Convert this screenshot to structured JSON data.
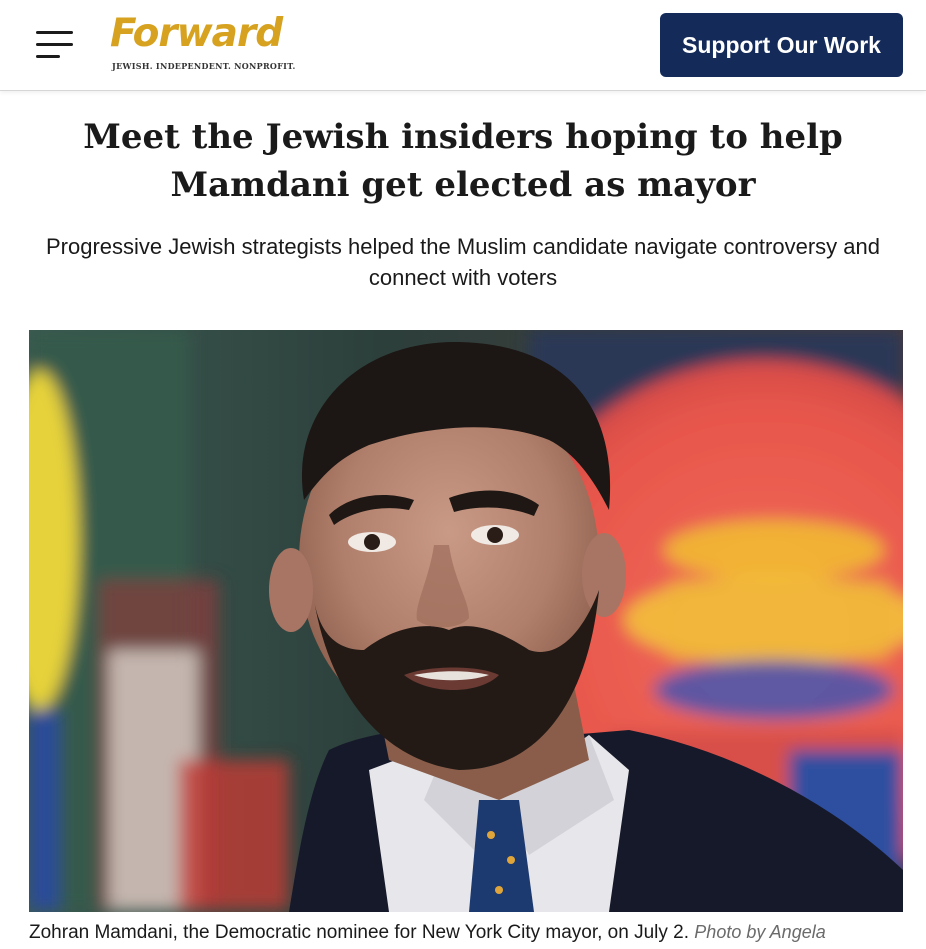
{
  "header": {
    "logo_text": "Forward",
    "logo_tagline": "JEWISH. INDEPENDENT. NONPROFIT.",
    "support_label": "Support Our Work",
    "brand_color": "#d6a21f",
    "button_color": "#142b5a",
    "menu_icon": "hamburger-menu-icon"
  },
  "article": {
    "headline": "Meet the Jewish insiders hoping to help Mamdani get elected as mayor",
    "subheadline": "Progressive Jewish strategists helped the Muslim candidate navigate controversy and connect with voters",
    "caption": "Zohran Mamdani, the Democratic nominee for New York City mayor, on July 2.",
    "photo_credit": "Photo by Angela"
  }
}
